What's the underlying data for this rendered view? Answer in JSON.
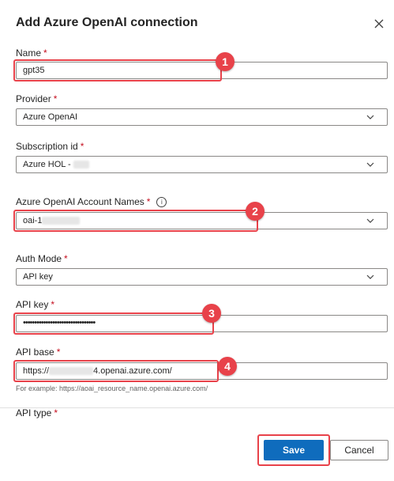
{
  "dialog": {
    "title": "Add Azure OpenAI connection"
  },
  "form": {
    "name": {
      "label": "Name",
      "required": "*",
      "value": "gpt35"
    },
    "provider": {
      "label": "Provider",
      "required": "*",
      "value": "Azure OpenAI"
    },
    "subscription": {
      "label": "Subscription id",
      "required": "*",
      "value": "Azure HOL -"
    },
    "account": {
      "label": "Azure OpenAI Account Names",
      "required": "*",
      "value": "oai-1"
    },
    "auth_mode": {
      "label": "Auth Mode",
      "required": "*",
      "value": "API key"
    },
    "api_key": {
      "label": "API key",
      "required": "*",
      "value": "••••••••••••••••••••••••••••••••"
    },
    "api_base": {
      "label": "API base",
      "required": "*",
      "value_prefix": "https://",
      "value_suffix": "4.openai.azure.com/",
      "hint": "For example: https://aoai_resource_name.openai.azure.com/"
    },
    "api_type": {
      "label": "API type",
      "required": "*"
    }
  },
  "annotations": {
    "badge1": "1",
    "badge2": "2",
    "badge3": "3",
    "badge4": "4"
  },
  "buttons": {
    "save": "Save",
    "cancel": "Cancel"
  },
  "colors": {
    "accent": "#0f6cbd",
    "highlight": "#e8424a",
    "required": "#c50f1f"
  },
  "icons": {
    "close": "close-icon",
    "chevron": "chevron-down-icon",
    "info": "info-icon"
  }
}
